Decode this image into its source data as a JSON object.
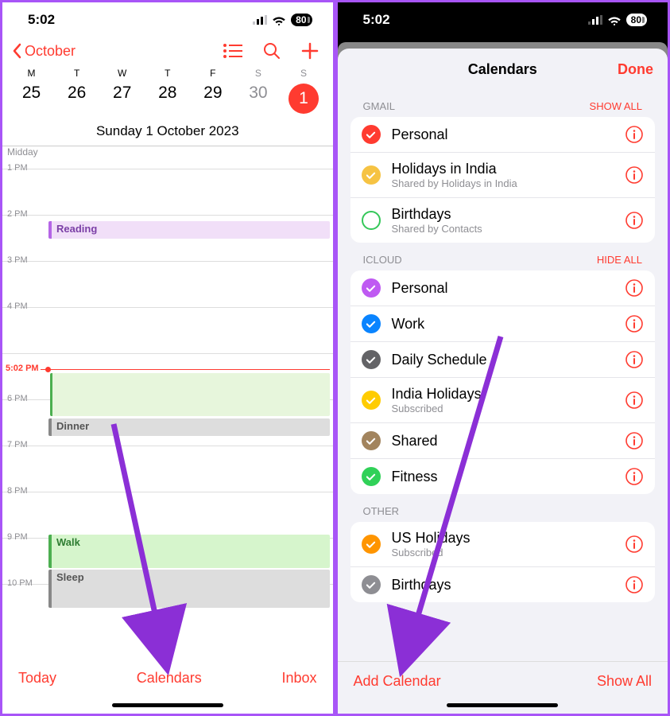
{
  "status": {
    "time": "5:02",
    "battery": "80"
  },
  "left": {
    "back_label": "October",
    "weekdays": [
      "M",
      "T",
      "W",
      "T",
      "F",
      "S",
      "S"
    ],
    "dates": [
      "25",
      "26",
      "27",
      "28",
      "29",
      "30",
      "1"
    ],
    "selected_date_title": "Sunday  1 October 2023",
    "midday": "Midday",
    "hours": [
      "1 PM",
      "2 PM",
      "3 PM",
      "4 PM",
      "",
      "6 PM",
      "7 PM",
      "8 PM",
      "9 PM",
      "10 PM"
    ],
    "now": "5:02 PM",
    "events": {
      "reading": "Reading",
      "dinner": "Dinner",
      "walk": "Walk",
      "sleep": "Sleep"
    },
    "toolbar": {
      "today": "Today",
      "calendars": "Calendars",
      "inbox": "Inbox"
    }
  },
  "right": {
    "title": "Calendars",
    "done": "Done",
    "sections": {
      "gmail": {
        "label": "GMAIL",
        "action": "SHOW ALL",
        "items": [
          {
            "name": "Personal",
            "sub": "",
            "color": "#ff3b30",
            "filled": true
          },
          {
            "name": "Holidays in India",
            "sub": "Shared by Holidays in India",
            "color": "#f6c343",
            "filled": true
          },
          {
            "name": "Birthdays",
            "sub": "Shared by Contacts",
            "color": "#34c759",
            "filled": false
          }
        ]
      },
      "icloud": {
        "label": "ICLOUD",
        "action": "HIDE ALL",
        "items": [
          {
            "name": "Personal",
            "sub": "",
            "color": "#bf5af2",
            "filled": true
          },
          {
            "name": "Work",
            "sub": "",
            "color": "#0a84ff",
            "filled": true
          },
          {
            "name": "Daily Schedule",
            "sub": "",
            "color": "#636366",
            "filled": true
          },
          {
            "name": "India Holidays",
            "sub": "Subscribed",
            "color": "#ffcc00",
            "filled": true
          },
          {
            "name": "Shared",
            "sub": "",
            "color": "#a2845e",
            "filled": true
          },
          {
            "name": "Fitness",
            "sub": "",
            "color": "#30d158",
            "filled": true
          }
        ]
      },
      "other": {
        "label": "OTHER",
        "action": "",
        "items": [
          {
            "name": "US Holidays",
            "sub": "Subscribed",
            "color": "#ff9500",
            "filled": true
          },
          {
            "name": "Birthdays",
            "sub": "",
            "color": "#8e8e93",
            "filled": true
          }
        ]
      }
    },
    "toolbar": {
      "add": "Add Calendar",
      "showall": "Show All"
    }
  }
}
